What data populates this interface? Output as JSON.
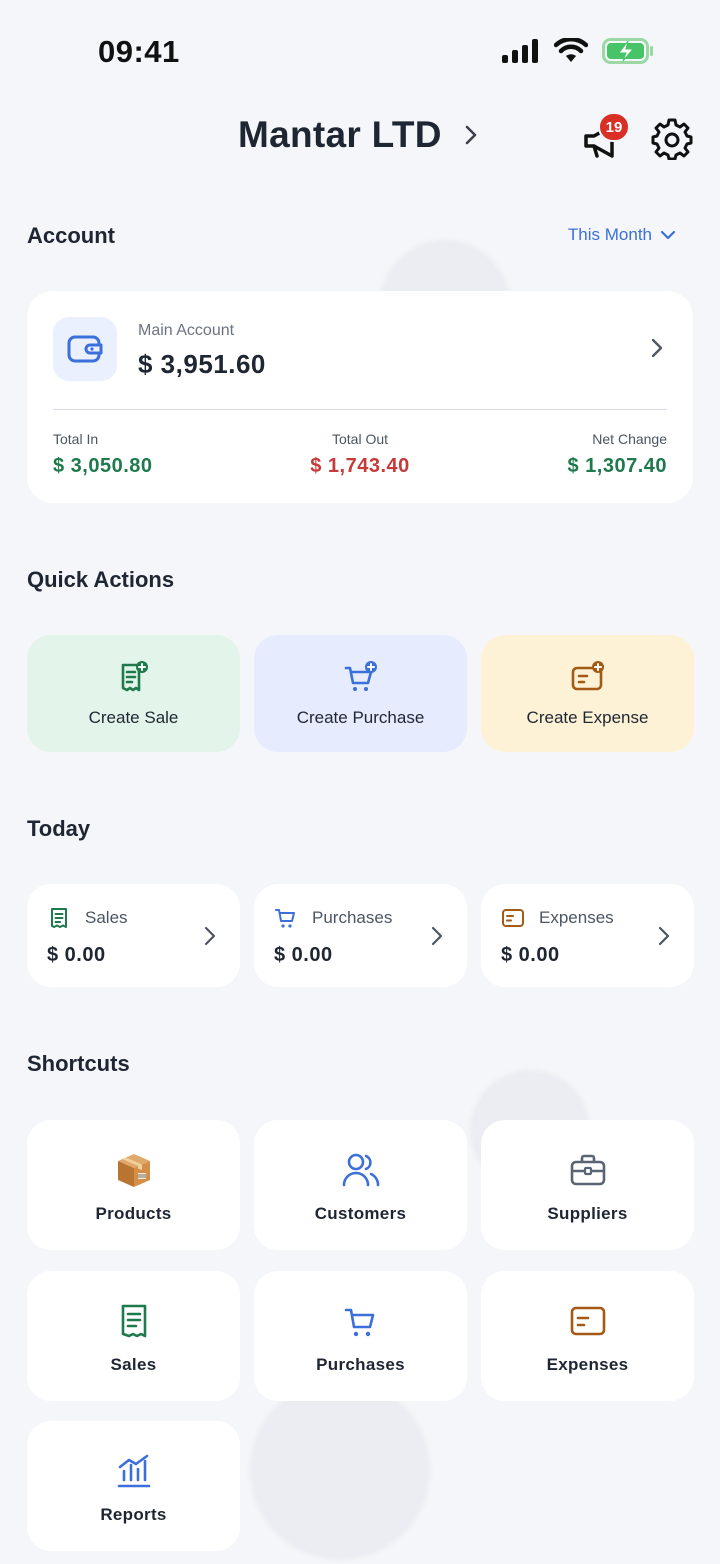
{
  "status_bar": {
    "time": "09:41"
  },
  "header": {
    "company_name": "Mantar LTD",
    "notification_count": "19"
  },
  "account": {
    "section_title": "Account",
    "period_label": "This Month",
    "main_label": "Main Account",
    "balance": "$ 3,951.60",
    "total_in_label": "Total In",
    "total_in_value": "$ 3,050.80",
    "total_out_label": "Total Out",
    "total_out_value": "$ 1,743.40",
    "net_change_label": "Net Change",
    "net_change_value": "$ 1,307.40"
  },
  "quick_actions": {
    "section_title": "Quick Actions",
    "items": [
      {
        "label": "Create Sale",
        "icon": "receipt-plus-icon"
      },
      {
        "label": "Create Purchase",
        "icon": "cart-plus-icon"
      },
      {
        "label": "Create Expense",
        "icon": "card-plus-icon"
      }
    ]
  },
  "today": {
    "section_title": "Today",
    "items": [
      {
        "label": "Sales",
        "amount": "$ 0.00",
        "icon": "receipt-icon"
      },
      {
        "label": "Purchases",
        "amount": "$ 0.00",
        "icon": "cart-icon"
      },
      {
        "label": "Expenses",
        "amount": "$ 0.00",
        "icon": "card-icon"
      }
    ]
  },
  "shortcuts": {
    "section_title": "Shortcuts",
    "items": [
      {
        "label": "Products",
        "icon": "package-icon"
      },
      {
        "label": "Customers",
        "icon": "users-icon"
      },
      {
        "label": "Suppliers",
        "icon": "briefcase-icon"
      },
      {
        "label": "Sales",
        "icon": "receipt-icon"
      },
      {
        "label": "Purchases",
        "icon": "cart-icon"
      },
      {
        "label": "Expenses",
        "icon": "card-icon"
      },
      {
        "label": "Reports",
        "icon": "chart-icon"
      }
    ]
  },
  "colors": {
    "accent_blue": "#3b6fd9",
    "positive_green": "#1e7a4c",
    "negative_red": "#c73a3a",
    "sale_bg": "#e3f4ea",
    "purchase_bg": "#e6ecfd",
    "expense_bg": "#fdf2d6",
    "expense_brown": "#a45a14"
  }
}
